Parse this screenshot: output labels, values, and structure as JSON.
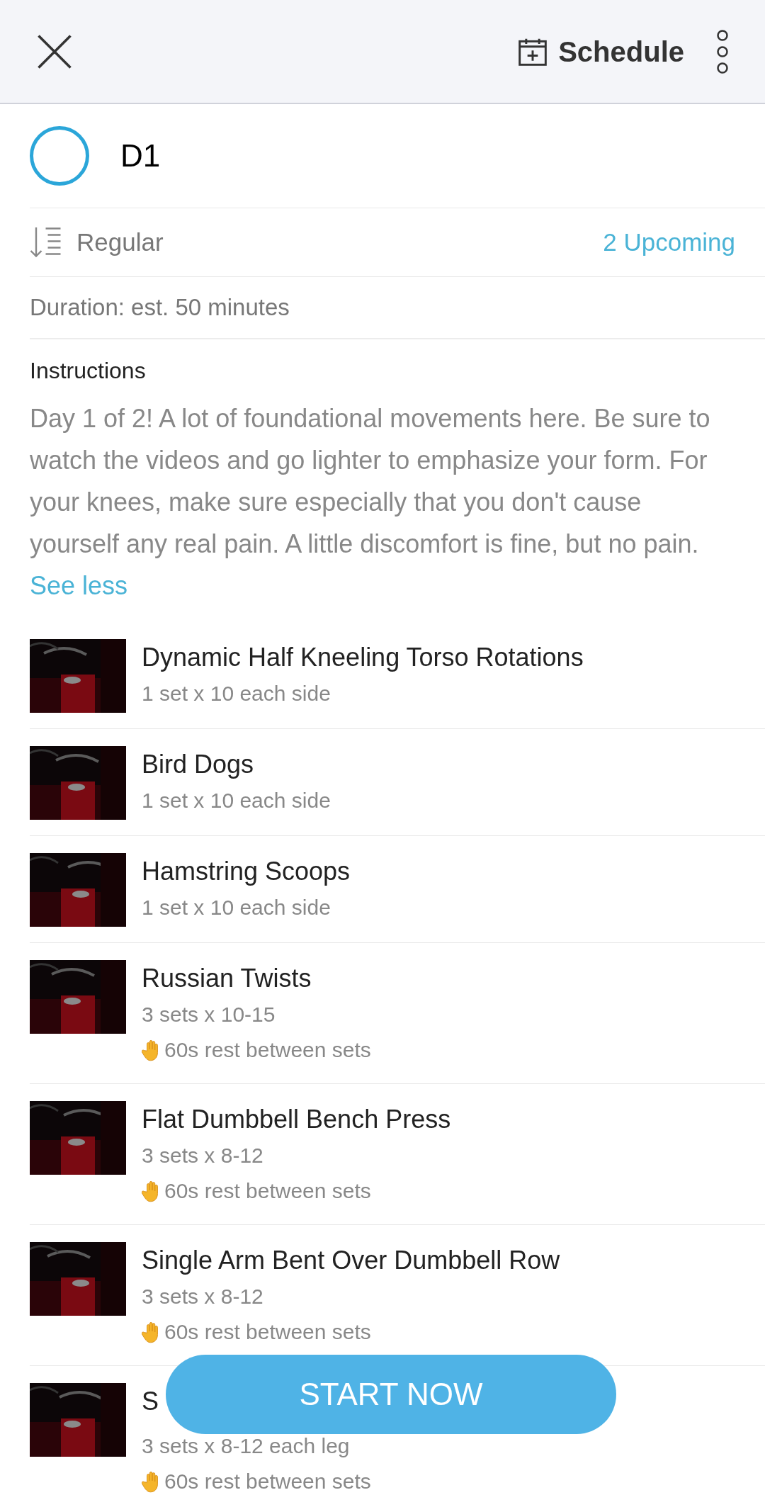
{
  "header": {
    "schedule": "Schedule"
  },
  "workout": {
    "title": "D1",
    "completed": false,
    "sort": "Regular",
    "upcoming": "2 Upcoming",
    "duration": "Duration: est. 50 minutes"
  },
  "instructions": {
    "label": "Instructions",
    "text": "Day 1 of 2! A lot of foundational movements here. Be sure to watch the videos and go lighter to emphasize your form. For your knees, make sure especially that you don't cause yourself any real pain. A little discomfort is fine, but no pain.",
    "link": "See less"
  },
  "exercises": [
    {
      "name": "Dynamic Half Kneeling Torso Rotations",
      "sets": "1 set x 10 each side"
    },
    {
      "name": "Bird Dogs",
      "sets": "1 set x 10 each side"
    },
    {
      "name": "Hamstring Scoops",
      "sets": "1 set x 10 each side"
    },
    {
      "name": "Russian Twists",
      "sets": "3 sets x 10-15",
      "rest": "60s rest between sets"
    },
    {
      "name": "Flat Dumbbell Bench Press",
      "sets": "3 sets x 8-12",
      "rest": "60s rest between sets"
    },
    {
      "name": "Single Arm Bent Over Dumbbell Row",
      "sets": "3 sets x 8-12",
      "rest": "60s rest between sets"
    },
    {
      "name": "S",
      "sets": "3 sets x 8-12 each leg",
      "rest": "60s rest between sets"
    }
  ],
  "start_button": "START NOW"
}
